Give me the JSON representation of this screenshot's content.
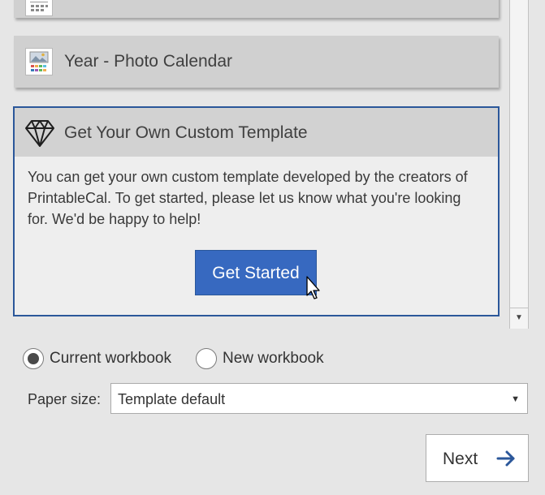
{
  "template_list": {
    "photo_calendar_title": "Year - Photo Calendar",
    "custom_template": {
      "title": "Get Your Own Custom Template",
      "description": "You can get your own custom template developed by the creators of PrintableCal. To get started, please let us know what you're looking for. We'd be happy to help!",
      "button_label": "Get Started"
    },
    "scroll_down_glyph": "▼"
  },
  "output_options": {
    "current_workbook_label": "Current workbook",
    "new_workbook_label": "New workbook",
    "selected": "Current workbook"
  },
  "paper_size": {
    "label": "Paper size:",
    "value": "Template default",
    "arrow_glyph": "▼"
  },
  "footer": {
    "next_label": "Next"
  },
  "colors": {
    "accent": "#2b579a",
    "button": "#3769c0",
    "background": "#e6e6e6",
    "card": "#d0d0d0"
  },
  "icons": [
    "calendar-grid-icon",
    "photo-calendar-icon",
    "diamond-icon",
    "mouse-cursor-icon",
    "arrow-right-icon"
  ]
}
